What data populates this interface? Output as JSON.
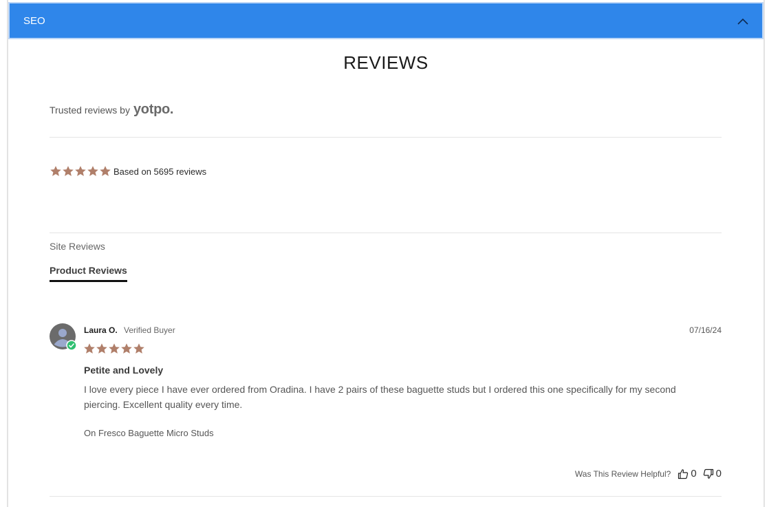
{
  "accordion": {
    "label": "SEO",
    "accent_color": "#2f86ea"
  },
  "reviews": {
    "title": "REVIEWS",
    "trusted_prefix": "Trusted reviews by",
    "trusted_brand": "yotpo.",
    "star_color": "#b07f6a",
    "rating_stars": 5,
    "summary_text": "Based on 5695 reviews",
    "tabs": [
      {
        "label": "Site Reviews",
        "active": false
      },
      {
        "label": "Product Reviews",
        "active": true
      }
    ],
    "items": [
      {
        "name": "Laura O.",
        "badge": "Verified Buyer",
        "date": "07/16/24",
        "stars": 5,
        "title": "Petite and Lovely",
        "body": "I love every piece I have ever ordered from Oradina. I have 2 pairs of these baguette studs but I ordered this one specifically for my second piercing. Excellent quality every time.",
        "product": "On Fresco Baguette Micro Studs",
        "helpful_label": "Was This Review Helpful?",
        "thumbs_up": "0",
        "thumbs_down": "0"
      }
    ]
  }
}
